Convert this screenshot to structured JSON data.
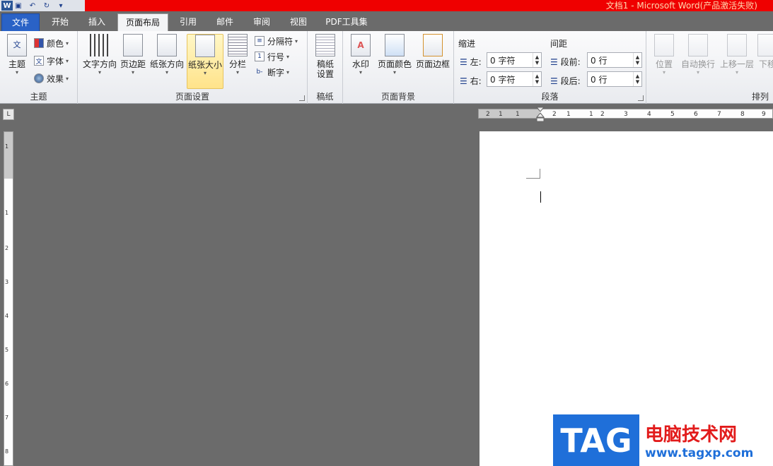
{
  "window": {
    "title": "文档1 - Microsoft Word(产品激活失败)"
  },
  "qat": {
    "logo": "W",
    "icons": [
      "save-icon",
      "undo-icon",
      "redo-icon",
      "customize-icon"
    ]
  },
  "tabs": [
    {
      "label": "文件"
    },
    {
      "label": "开始"
    },
    {
      "label": "插入"
    },
    {
      "label": "页面布局"
    },
    {
      "label": "引用"
    },
    {
      "label": "邮件"
    },
    {
      "label": "审阅"
    },
    {
      "label": "视图"
    },
    {
      "label": "PDF工具集"
    }
  ],
  "groups": {
    "theme": {
      "label": "主题",
      "theme_btn": "主题",
      "colors": "颜色",
      "fonts": "字体",
      "effects": "效果"
    },
    "page_setup": {
      "label": "页面设置",
      "text_direction": "文字方向",
      "margins": "页边距",
      "orientation": "纸张方向",
      "size": "纸张大小",
      "columns": "分栏",
      "breaks": "分隔符",
      "line_numbers": "行号",
      "hyphenation": "断字"
    },
    "manuscript": {
      "label": "稿纸",
      "btn_line1": "稿纸",
      "btn_line2": "设置"
    },
    "page_background": {
      "label": "页面背景",
      "watermark": "水印",
      "page_color": "页面颜色",
      "page_borders": "页面边框"
    },
    "paragraph": {
      "label": "段落",
      "indent": "缩进",
      "spacing": "间距",
      "left": "左:",
      "right": "右:",
      "before": "段前:",
      "after": "段后:",
      "left_val": "0 字符",
      "right_val": "0 字符",
      "before_val": "0 行",
      "after_val": "0 行"
    },
    "arrange": {
      "label": "排列",
      "position": "位置",
      "wrap": "自动换行",
      "bring_forward": "上移一层",
      "send_backward": "下移"
    }
  },
  "ruler": {
    "h_ticks": [
      "2",
      "1",
      "1",
      "2",
      "1",
      "1",
      "2",
      "3",
      "4",
      "5",
      "6",
      "7",
      "8",
      "9"
    ],
    "v_ticks": [
      "1",
      "1",
      "2",
      "3",
      "4",
      "5",
      "6",
      "7",
      "8"
    ]
  },
  "watermark": {
    "tag": "TAG",
    "site_name": "电脑技术网",
    "url": "www.tagxp.com"
  }
}
